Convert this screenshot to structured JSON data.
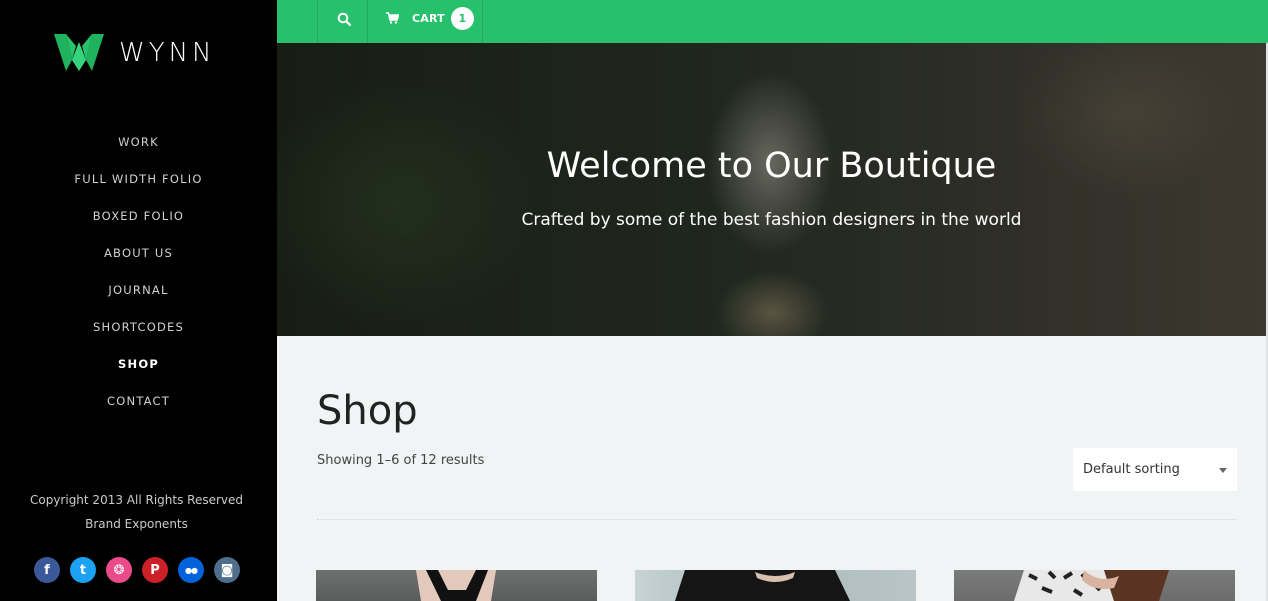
{
  "brand": {
    "name": "WYNN",
    "accent": "#27c16b"
  },
  "nav": {
    "items": [
      {
        "label": "WORK",
        "active": false
      },
      {
        "label": "FULL WIDTH FOLIO",
        "active": false
      },
      {
        "label": "BOXED FOLIO",
        "active": false
      },
      {
        "label": "ABOUT US",
        "active": false
      },
      {
        "label": "JOURNAL",
        "active": false
      },
      {
        "label": "SHORTCODES",
        "active": false
      },
      {
        "label": "SHOP",
        "active": true
      },
      {
        "label": "CONTACT",
        "active": false
      }
    ]
  },
  "footer": {
    "copyright": "Copyright 2013 All Rights Reserved",
    "company": "Brand Exponents",
    "socials": [
      {
        "name": "facebook-icon",
        "glyph": "f",
        "color": "#3b5998"
      },
      {
        "name": "twitter-icon",
        "glyph": "t",
        "color": "#1da1f2"
      },
      {
        "name": "dribbble-icon",
        "glyph": "❂",
        "color": "#ea4c89"
      },
      {
        "name": "pinterest-icon",
        "glyph": "P",
        "color": "#cb2027"
      },
      {
        "name": "flickr-icon",
        "glyph": "●●",
        "color": "#0063dc"
      },
      {
        "name": "instagram-icon",
        "glyph": "◙",
        "color": "#4e6e8c"
      }
    ]
  },
  "topbar": {
    "search_icon": "search-icon",
    "cart_icon": "cart-icon",
    "cart_label": "CART",
    "cart_count": "1"
  },
  "hero": {
    "title": "Welcome to Our Boutique",
    "subtitle": "Crafted by some of the best fashion designers in the world"
  },
  "shop": {
    "title": "Shop",
    "result_count": "Showing 1–6 of 12 results",
    "sort_selected": "Default sorting"
  }
}
